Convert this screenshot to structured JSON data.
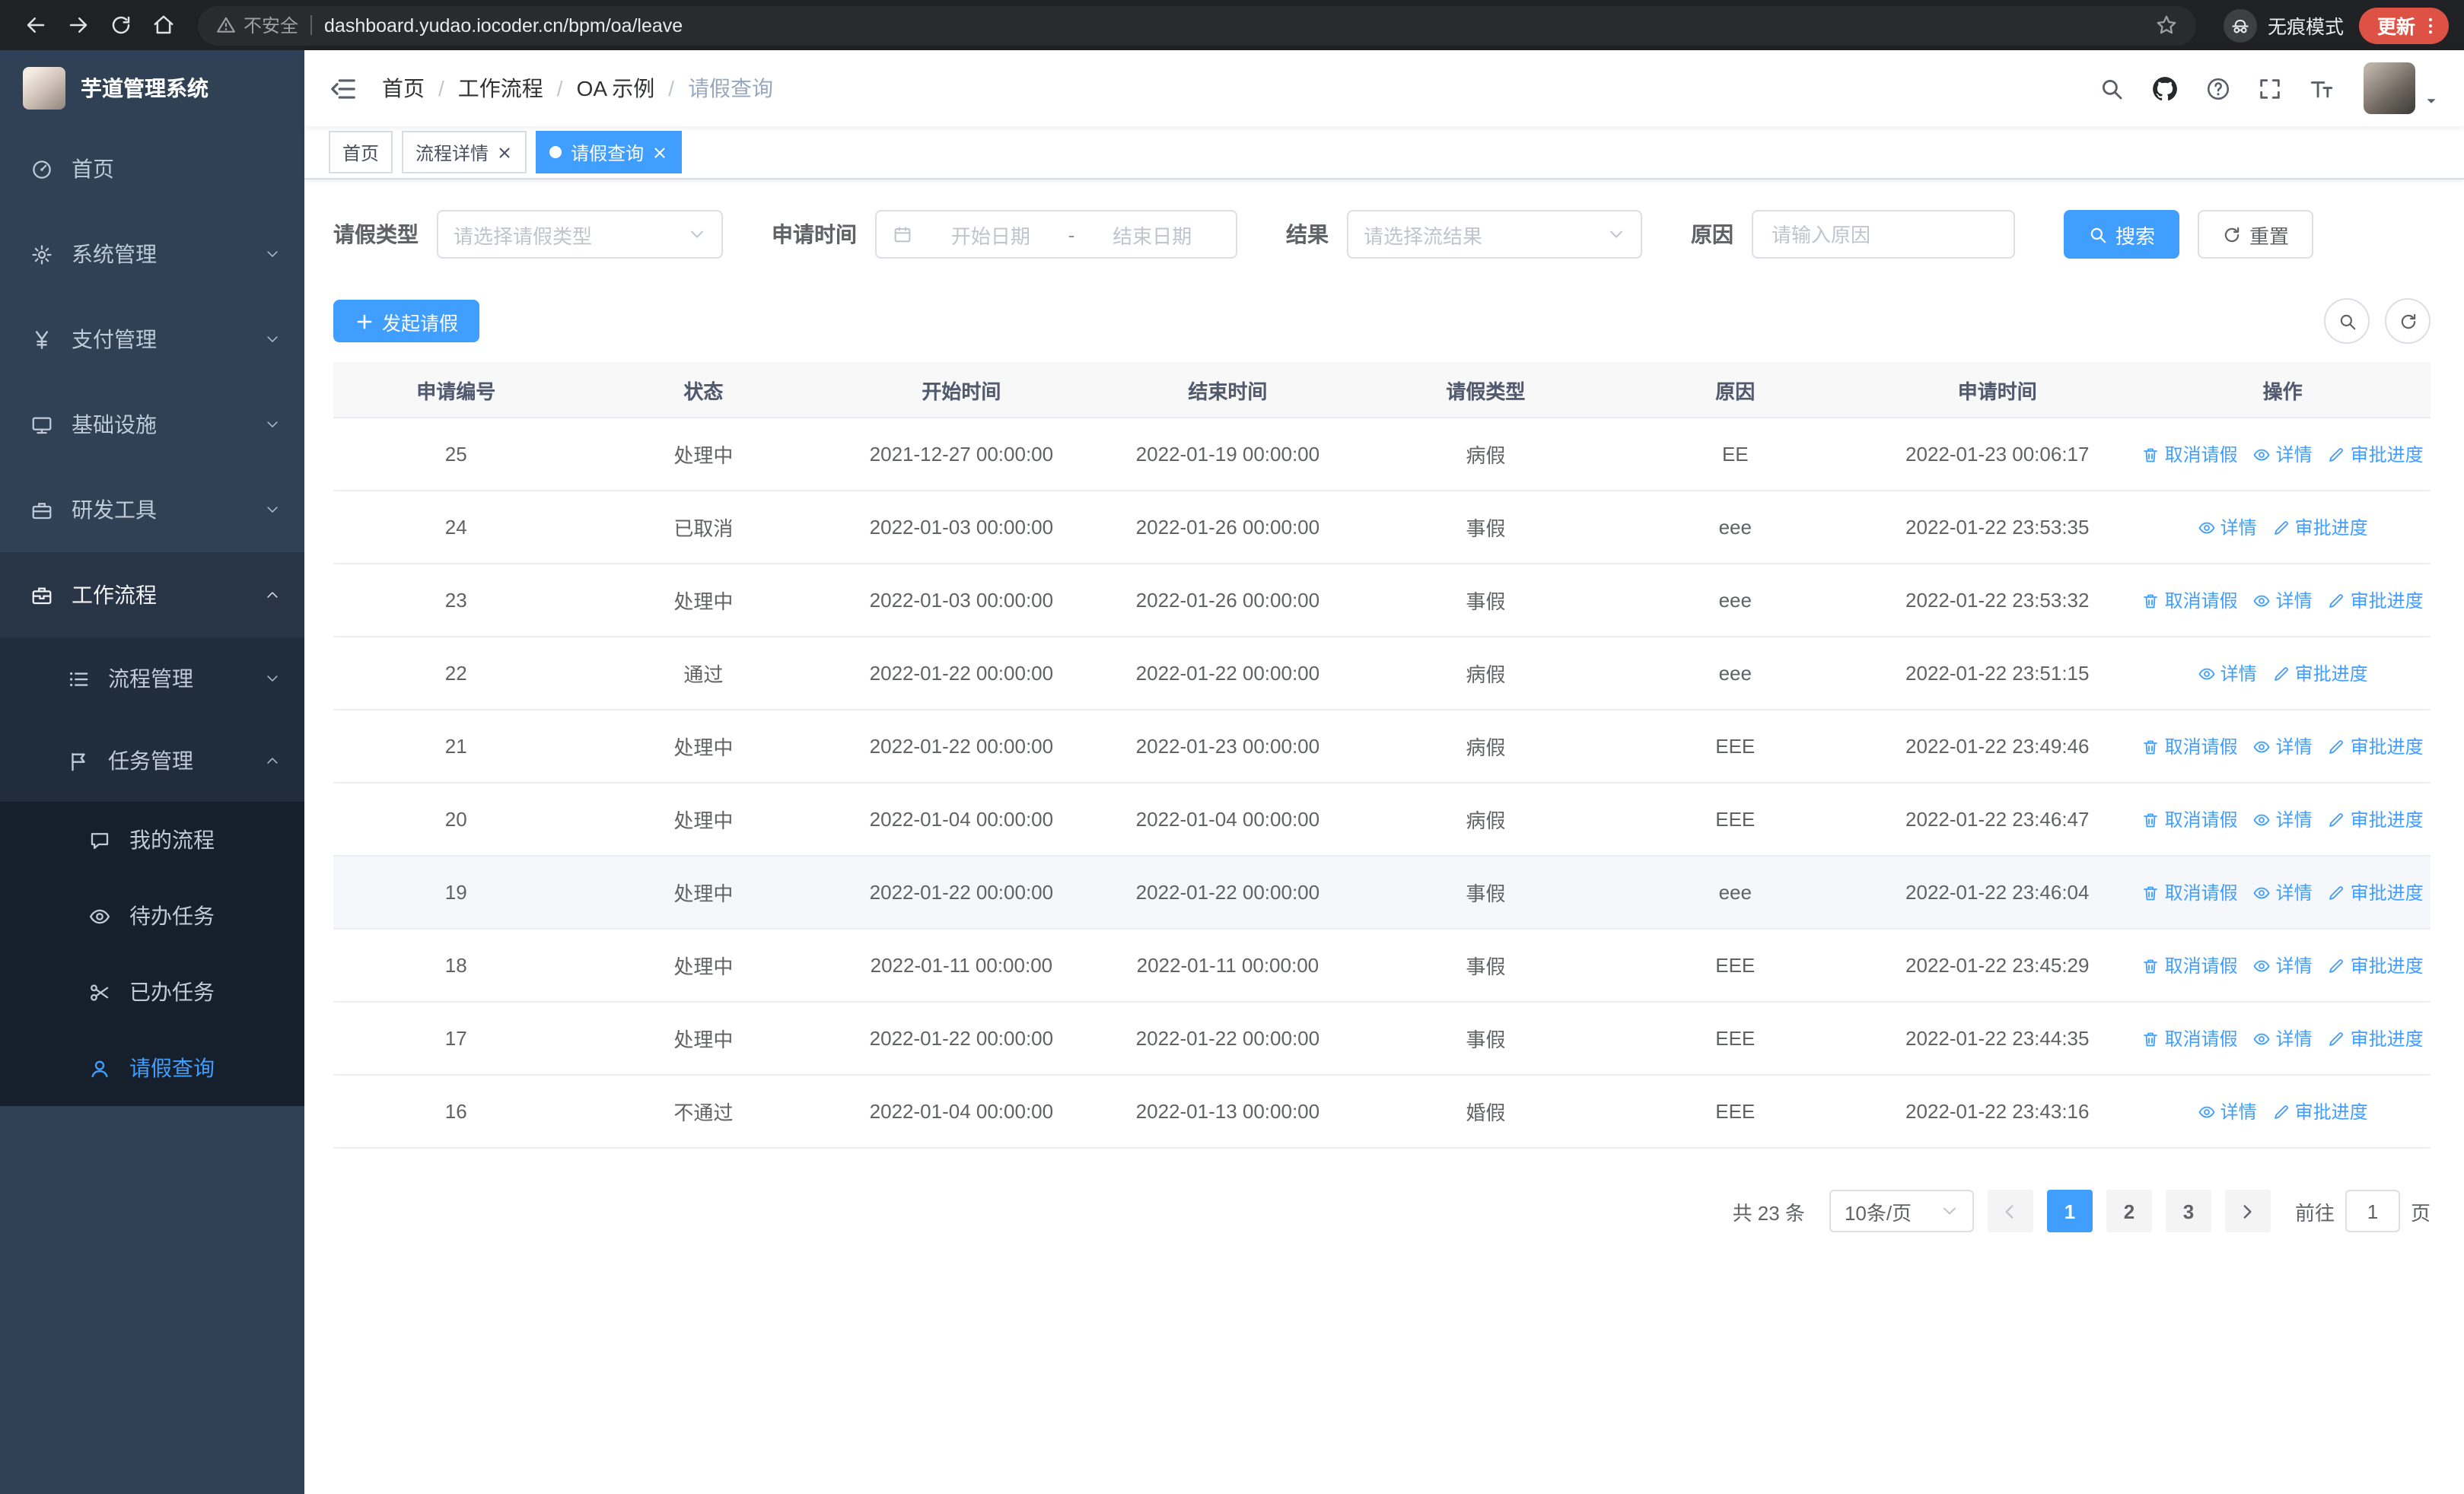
{
  "colors": {
    "accent": "#409EFF",
    "sidebar_bg": "#304156",
    "submenu_bg": "#1f2d3d",
    "browser_bg": "#202124",
    "header_bg": "#f8f8f9"
  },
  "browser": {
    "security_label": "不安全",
    "url": "dashboard.yudao.iocoder.cn/bpm/oa/leave",
    "incognito_label": "无痕模式",
    "update_label": "更新"
  },
  "sidebar": {
    "logo_title": "芋道管理系统",
    "items": [
      {
        "label": "首页",
        "icon": "gauge",
        "level": 1
      },
      {
        "label": "系统管理",
        "icon": "gear",
        "level": 1,
        "chevron": "down"
      },
      {
        "label": "支付管理",
        "icon": "yen",
        "level": 1,
        "chevron": "down"
      },
      {
        "label": "基础设施",
        "icon": "monitor",
        "level": 1,
        "chevron": "down"
      },
      {
        "label": "研发工具",
        "icon": "toolbox",
        "level": 1,
        "chevron": "down"
      },
      {
        "label": "工作流程",
        "icon": "briefcase",
        "level": 1,
        "chevron": "up",
        "open": true
      },
      {
        "label": "流程管理",
        "icon": "list",
        "level": 2,
        "chevron": "down"
      },
      {
        "label": "任务管理",
        "icon": "flag",
        "level": 2,
        "chevron": "up"
      },
      {
        "label": "我的流程",
        "icon": "message",
        "level": 3
      },
      {
        "label": "待办任务",
        "icon": "eye",
        "level": 3
      },
      {
        "label": "已办任务",
        "icon": "scissors",
        "level": 3
      },
      {
        "label": "请假查询",
        "icon": "user",
        "level": 3,
        "active": true
      }
    ]
  },
  "navbar": {
    "breadcrumb": [
      "首页",
      "工作流程",
      "OA 示例",
      "请假查询"
    ]
  },
  "tabs": [
    {
      "label": "首页"
    },
    {
      "label": "流程详情",
      "closable": true
    },
    {
      "label": "请假查询",
      "closable": true,
      "active": true
    }
  ],
  "filters": {
    "leave_type_label": "请假类型",
    "leave_type_placeholder": "请选择请假类型",
    "apply_time_label": "申请时间",
    "start_date_placeholder": "开始日期",
    "date_separator": "-",
    "end_date_placeholder": "结束日期",
    "result_label": "结果",
    "result_placeholder": "请选择流结果",
    "reason_label": "原因",
    "reason_placeholder": "请输入原因",
    "search_label": "搜索",
    "reset_label": "重置"
  },
  "toolbar": {
    "create_label": "发起请假"
  },
  "table": {
    "columns": [
      "申请编号",
      "状态",
      "开始时间",
      "结束时间",
      "请假类型",
      "原因",
      "申请时间",
      "操作"
    ],
    "col_widths": [
      "11.7%",
      "11.9%",
      "12.7%",
      "12.7%",
      "11.9%",
      "11.9%",
      "13.1%",
      "14.1%"
    ],
    "rows": [
      {
        "id": "25",
        "status": "处理中",
        "start": "2021-12-27 00:00:00",
        "end": "2022-01-19 00:00:00",
        "type": "病假",
        "reason": "EE",
        "apply_time": "2022-01-23 00:06:17",
        "actions": [
          {
            "label": "取消请假",
            "icon": "trash"
          },
          {
            "label": "详情",
            "icon": "eye"
          },
          {
            "label": "审批进度",
            "icon": "edit"
          }
        ]
      },
      {
        "id": "24",
        "status": "已取消",
        "start": "2022-01-03 00:00:00",
        "end": "2022-01-26 00:00:00",
        "type": "事假",
        "reason": "eee",
        "apply_time": "2022-01-22 23:53:35",
        "actions": [
          {
            "label": "详情",
            "icon": "eye"
          },
          {
            "label": "审批进度",
            "icon": "edit"
          }
        ]
      },
      {
        "id": "23",
        "status": "处理中",
        "start": "2022-01-03 00:00:00",
        "end": "2022-01-26 00:00:00",
        "type": "事假",
        "reason": "eee",
        "apply_time": "2022-01-22 23:53:32",
        "actions": [
          {
            "label": "取消请假",
            "icon": "trash"
          },
          {
            "label": "详情",
            "icon": "eye"
          },
          {
            "label": "审批进度",
            "icon": "edit"
          }
        ]
      },
      {
        "id": "22",
        "status": "通过",
        "start": "2022-01-22 00:00:00",
        "end": "2022-01-22 00:00:00",
        "type": "病假",
        "reason": "eee",
        "apply_time": "2022-01-22 23:51:15",
        "actions": [
          {
            "label": "详情",
            "icon": "eye"
          },
          {
            "label": "审批进度",
            "icon": "edit"
          }
        ]
      },
      {
        "id": "21",
        "status": "处理中",
        "start": "2022-01-22 00:00:00",
        "end": "2022-01-23 00:00:00",
        "type": "病假",
        "reason": "EEE",
        "apply_time": "2022-01-22 23:49:46",
        "actions": [
          {
            "label": "取消请假",
            "icon": "trash"
          },
          {
            "label": "详情",
            "icon": "eye"
          },
          {
            "label": "审批进度",
            "icon": "edit"
          }
        ]
      },
      {
        "id": "20",
        "status": "处理中",
        "start": "2022-01-04 00:00:00",
        "end": "2022-01-04 00:00:00",
        "type": "病假",
        "reason": "EEE",
        "apply_time": "2022-01-22 23:46:47",
        "actions": [
          {
            "label": "取消请假",
            "icon": "trash"
          },
          {
            "label": "详情",
            "icon": "eye"
          },
          {
            "label": "审批进度",
            "icon": "edit"
          }
        ]
      },
      {
        "id": "19",
        "status": "处理中",
        "start": "2022-01-22 00:00:00",
        "end": "2022-01-22 00:00:00",
        "type": "事假",
        "reason": "eee",
        "apply_time": "2022-01-22 23:46:04",
        "highlighted": true,
        "actions": [
          {
            "label": "取消请假",
            "icon": "trash"
          },
          {
            "label": "详情",
            "icon": "eye"
          },
          {
            "label": "审批进度",
            "icon": "edit"
          }
        ]
      },
      {
        "id": "18",
        "status": "处理中",
        "start": "2022-01-11 00:00:00",
        "end": "2022-01-11 00:00:00",
        "type": "事假",
        "reason": "EEE",
        "apply_time": "2022-01-22 23:45:29",
        "actions": [
          {
            "label": "取消请假",
            "icon": "trash"
          },
          {
            "label": "详情",
            "icon": "eye"
          },
          {
            "label": "审批进度",
            "icon": "edit"
          }
        ]
      },
      {
        "id": "17",
        "status": "处理中",
        "start": "2022-01-22 00:00:00",
        "end": "2022-01-22 00:00:00",
        "type": "事假",
        "reason": "EEE",
        "apply_time": "2022-01-22 23:44:35",
        "actions": [
          {
            "label": "取消请假",
            "icon": "trash"
          },
          {
            "label": "详情",
            "icon": "eye"
          },
          {
            "label": "审批进度",
            "icon": "edit"
          }
        ]
      },
      {
        "id": "16",
        "status": "不通过",
        "start": "2022-01-04 00:00:00",
        "end": "2022-01-13 00:00:00",
        "type": "婚假",
        "reason": "EEE",
        "apply_time": "2022-01-22 23:43:16",
        "actions": [
          {
            "label": "详情",
            "icon": "eye"
          },
          {
            "label": "审批进度",
            "icon": "edit"
          }
        ]
      }
    ]
  },
  "pagination": {
    "total_label": "共 23 条",
    "page_size_label": "10条/页",
    "pages": [
      "1",
      "2",
      "3"
    ],
    "active_page": "1",
    "prev_disabled": true,
    "goto_label": "前往",
    "goto_value": "1",
    "unit_label": "页"
  }
}
